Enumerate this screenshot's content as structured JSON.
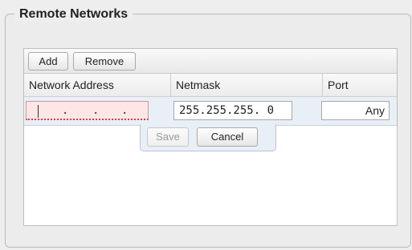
{
  "section": {
    "title": "Remote Networks"
  },
  "toolbar": {
    "add_label": "Add",
    "remove_label": "Remove"
  },
  "table": {
    "columns": [
      "Network Address",
      "Netmask",
      "Port"
    ]
  },
  "edit_row": {
    "network_address": {
      "value": "",
      "separators": [
        ".",
        ".",
        "."
      ],
      "invalid": true
    },
    "netmask": {
      "value": "255.255.255. 0"
    },
    "port": {
      "value": "Any"
    }
  },
  "row_actions": {
    "save_label": "Save",
    "cancel_label": "Cancel",
    "save_disabled": true
  }
}
